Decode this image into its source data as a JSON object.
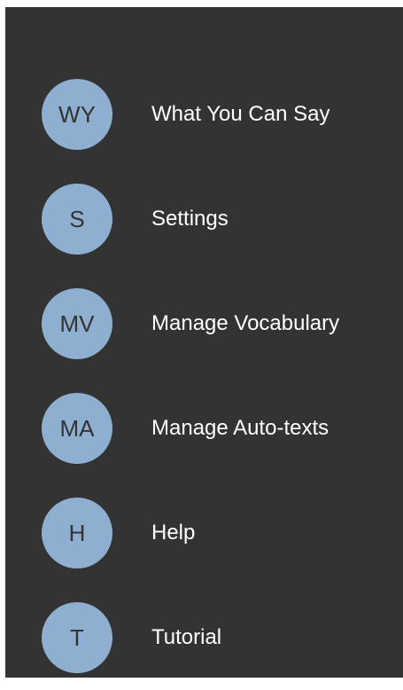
{
  "colors": {
    "panel_background": "#333333",
    "avatar_background": "#8eafcf",
    "avatar_text": "#333333",
    "label_text": "#ffffff"
  },
  "menu": {
    "items": [
      {
        "initials": "WY",
        "label": "What You Can Say"
      },
      {
        "initials": "S",
        "label": "Settings"
      },
      {
        "initials": "MV",
        "label": "Manage Vocabulary"
      },
      {
        "initials": "MA",
        "label": "Manage Auto-texts"
      },
      {
        "initials": "H",
        "label": "Help"
      },
      {
        "initials": "T",
        "label": "Tutorial"
      }
    ]
  }
}
